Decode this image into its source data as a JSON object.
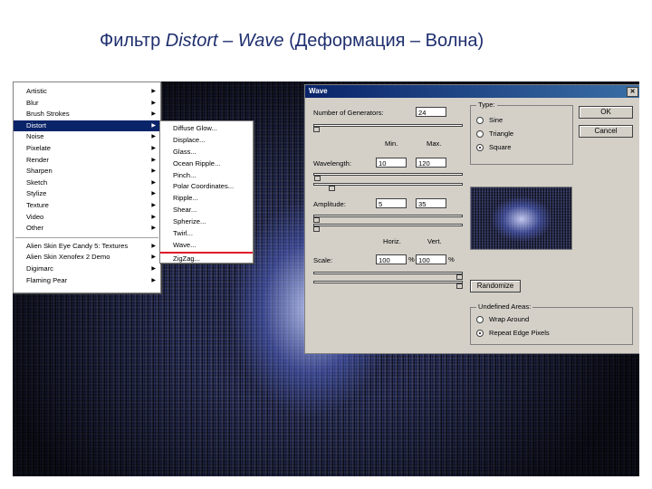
{
  "slide": {
    "title_prefix": "Фильтр ",
    "title_italic": "Distort – Wave",
    "title_suffix": " (Деформация – Волна)"
  },
  "menu": {
    "items": [
      {
        "label": "Artistic",
        "has_submenu": true
      },
      {
        "label": "Blur",
        "has_submenu": true
      },
      {
        "label": "Brush Strokes",
        "has_submenu": true
      },
      {
        "label": "Distort",
        "has_submenu": true,
        "selected": true
      },
      {
        "label": "Noise",
        "has_submenu": true
      },
      {
        "label": "Pixelate",
        "has_submenu": true
      },
      {
        "label": "Render",
        "has_submenu": true
      },
      {
        "label": "Sharpen",
        "has_submenu": true
      },
      {
        "label": "Sketch",
        "has_submenu": true
      },
      {
        "label": "Stylize",
        "has_submenu": true
      },
      {
        "label": "Texture",
        "has_submenu": true
      },
      {
        "label": "Video",
        "has_submenu": true
      },
      {
        "label": "Other",
        "has_submenu": true
      }
    ],
    "plugins": [
      {
        "label": "Alien Skin Eye Candy 5: Textures",
        "has_submenu": true
      },
      {
        "label": "Alien Skin Xenofex 2 Demo",
        "has_submenu": true
      },
      {
        "label": "Digimarc",
        "has_submenu": true
      },
      {
        "label": "Flaming Pear",
        "has_submenu": true
      }
    ],
    "arrow": "▶"
  },
  "submenu": {
    "items": [
      "Diffuse Glow...",
      "Displace...",
      "Glass...",
      "Ocean Ripple...",
      "Pinch...",
      "Polar Coordinates...",
      "Ripple...",
      "Shear...",
      "Spherize...",
      "Twirl...",
      "Wave...",
      "ZigZag..."
    ],
    "highlight_index": 10,
    "highlight_color": "#e0162b"
  },
  "dialog": {
    "title": "Wave",
    "close_label": "✕",
    "generators_label": "Number of Generators:",
    "generators_value": "24",
    "min_label": "Min.",
    "max_label": "Max.",
    "wavelength_label": "Wavelength:",
    "wavelength_min": "10",
    "wavelength_max": "120",
    "amplitude_label": "Amplitude:",
    "amplitude_min": "5",
    "amplitude_max": "35",
    "horiz_label": "Horiz.",
    "vert_label": "Vert.",
    "scale_label": "Scale:",
    "scale_horiz": "100",
    "scale_vert": "100",
    "percent": "%",
    "type_label": "Type:",
    "type_options": [
      {
        "label": "Sine",
        "checked": false
      },
      {
        "label": "Triangle",
        "checked": false
      },
      {
        "label": "Square",
        "checked": true
      }
    ],
    "ok_label": "OK",
    "cancel_label": "Cancel",
    "randomize_label": "Randomize",
    "undefined_label": "Undefined Areas:",
    "undefined_options": [
      {
        "label": "Wrap Around",
        "checked": false
      },
      {
        "label": "Repeat Edge Pixels",
        "checked": true
      }
    ]
  },
  "colors": {
    "title_text": "#1e2e6e",
    "menu_selection": "#0a246a",
    "dialog_face": "#d4d0c8"
  }
}
